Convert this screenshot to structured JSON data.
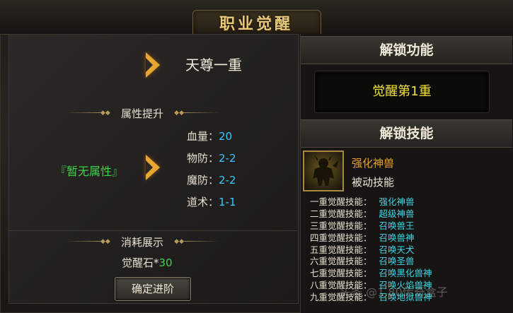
{
  "title": "职业觉醒",
  "current_realm": "天尊一重",
  "attributes": {
    "header": "属性提升",
    "current": "『暂无属性』",
    "stats": [
      {
        "label": "血量：",
        "value": "20"
      },
      {
        "label": "物防：",
        "value": "2-2"
      },
      {
        "label": "魔防：",
        "value": "2-2"
      },
      {
        "label": "道术：",
        "value": "1-1"
      }
    ]
  },
  "cost": {
    "header": "消耗展示",
    "item_label": "觉醒石*",
    "item_count": "30"
  },
  "confirm_button": "确定进阶",
  "unlock_feature": {
    "header": "解锁功能",
    "value": "觉醒第1重"
  },
  "unlock_skill": {
    "header": "解锁技能",
    "skill_name": "强化神兽",
    "skill_type": "被动技能",
    "icon": "beast-warrior-icon",
    "list": [
      {
        "label": "一重觉醒技能：",
        "skill": "强化神兽"
      },
      {
        "label": "二重觉醒技能：",
        "skill": "超级神兽"
      },
      {
        "label": "三重觉醒技能：",
        "skill": "召唤兽王"
      },
      {
        "label": "四重觉醒技能：",
        "skill": "召唤兽神"
      },
      {
        "label": "五重觉醒技能：",
        "skill": "召唤天犬"
      },
      {
        "label": "六重觉醒技能：",
        "skill": "召唤圣兽"
      },
      {
        "label": "七重觉醒技能：",
        "skill": "召唤黑化兽神"
      },
      {
        "label": "八重觉醒技能：",
        "skill": "召唤火焰兽神"
      },
      {
        "label": "九重觉醒技能：",
        "skill": "召唤地狱兽神"
      }
    ]
  },
  "watermark": "头条 @1.80传奇盒子",
  "colors": {
    "accent_gold": "#e8c979",
    "stat_value": "#39c6ff",
    "green": "#3fd34a",
    "skill_cyan": "#3ad8e8",
    "yellow": "#f2e23a"
  }
}
